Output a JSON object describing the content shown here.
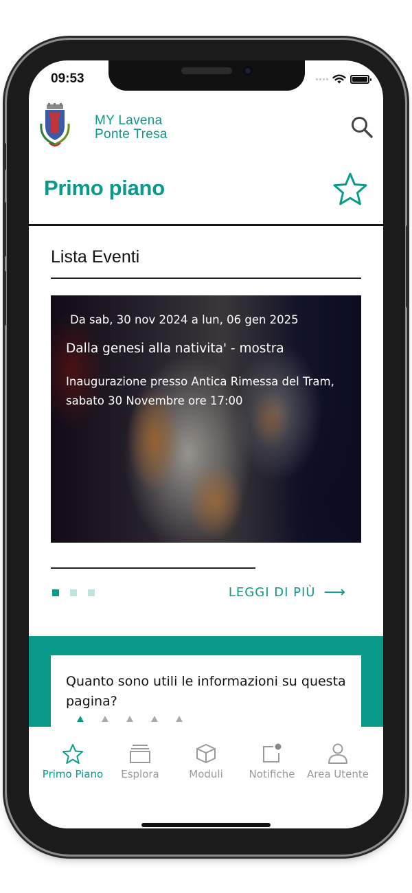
{
  "status_bar": {
    "time": "09:53"
  },
  "header": {
    "brand_line1": "MY Lavena",
    "brand_line2": "Ponte Tresa",
    "page_title": "Primo piano",
    "search_icon": "search-icon",
    "favorite_icon": "star-icon"
  },
  "section": {
    "title": "Lista Eventi",
    "event": {
      "date": "Da sab, 30 nov 2024 a lun, 06 gen 2025",
      "title": "Dalla genesi alla nativita' - mostra",
      "description": "Inaugurazione presso Antica Rimessa del Tram, sabato 30 Novembre ore 17:00"
    },
    "pagination": {
      "count": 3,
      "active": 0
    },
    "more_link": "LEGGI DI PIÙ",
    "more_arrow": "⟶"
  },
  "feedback": {
    "question": "Quanto sono utili le informazioni su questa pagina?",
    "rating_count": 5,
    "rating_active": 0
  },
  "tabbar": {
    "items": [
      {
        "label": "Primo Piano",
        "icon": "star-icon",
        "active": true
      },
      {
        "label": "Esplora",
        "icon": "stack-icon",
        "active": false
      },
      {
        "label": "Moduli",
        "icon": "cube-icon",
        "active": false
      },
      {
        "label": "Notifiche",
        "icon": "notification-icon",
        "active": false
      },
      {
        "label": "Area Utente",
        "icon": "user-icon",
        "active": false
      }
    ]
  },
  "colors": {
    "accent": "#0a9a8a",
    "inactive": "#9a9a9a",
    "text": "#111111"
  }
}
